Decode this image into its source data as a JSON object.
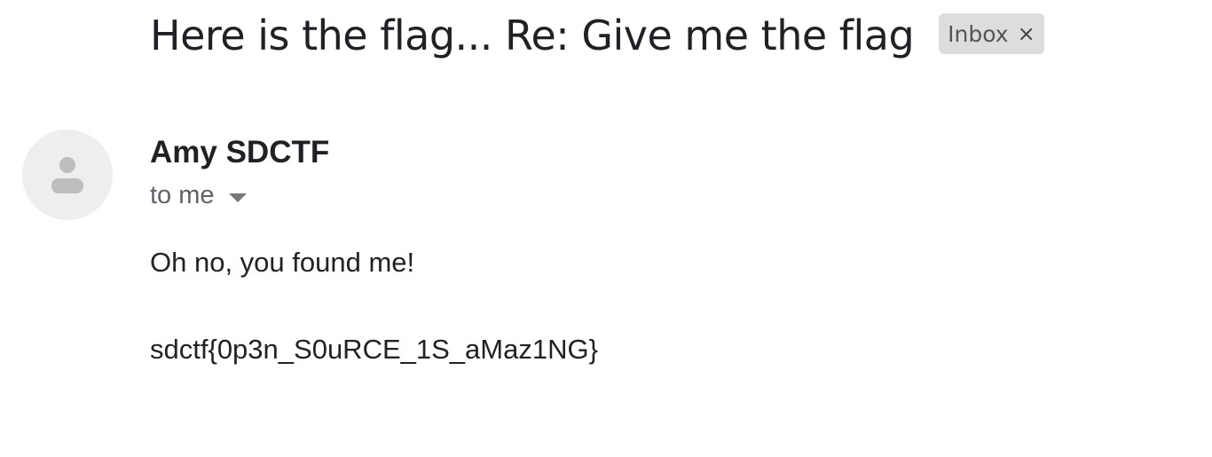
{
  "email": {
    "subject": "Here is the flag... Re: Give me the flag",
    "label": {
      "text": "Inbox",
      "close_glyph": "×"
    },
    "sender": {
      "name": "Amy SDCTF",
      "avatar_icon": "person-icon"
    },
    "recipient": {
      "text": "to me",
      "details_icon": "caret-down-icon"
    },
    "body": [
      "Oh no, you found me!",
      "sdctf{0p3n_S0uRCE_1S_aMaz1NG}"
    ]
  },
  "colors": {
    "avatar_bg": "#eeeeee",
    "avatar_figure": "#bdbdbd",
    "chip_bg": "#dddddd"
  }
}
